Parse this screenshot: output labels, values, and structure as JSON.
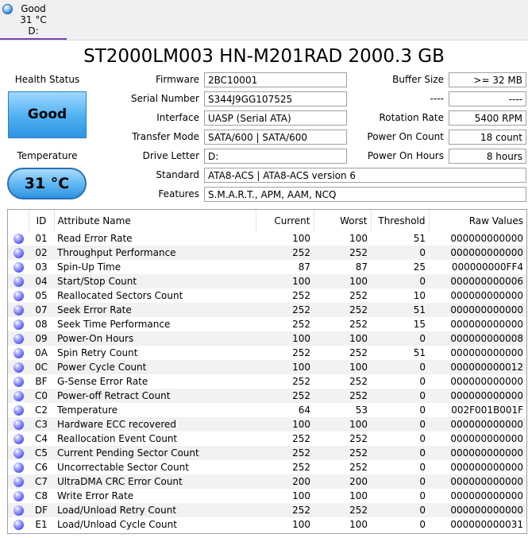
{
  "disk_tab": {
    "status": "Good",
    "temperature": "31 °C",
    "drive": "D:"
  },
  "title": "ST2000LM003 HN-M201RAD 2000.3 GB",
  "health": {
    "label": "Health Status",
    "value": "Good"
  },
  "temperature": {
    "label": "Temperature",
    "value": "31 °C"
  },
  "info_left": [
    {
      "label": "Firmware",
      "value": "2BC10001"
    },
    {
      "label": "Serial Number",
      "value": "S344J9GG107525"
    },
    {
      "label": "Interface",
      "value": "UASP (Serial ATA)"
    },
    {
      "label": "Transfer Mode",
      "value": "SATA/600 | SATA/600"
    },
    {
      "label": "Drive Letter",
      "value": "D:"
    }
  ],
  "info_right": [
    {
      "label": "Buffer Size",
      "value": ">= 32 MB"
    },
    {
      "label": "----",
      "value": "----"
    },
    {
      "label": "Rotation Rate",
      "value": "5400 RPM"
    },
    {
      "label": "Power On Count",
      "value": "18 count"
    },
    {
      "label": "Power On Hours",
      "value": "8 hours"
    }
  ],
  "standard": {
    "label": "Standard",
    "value": "ATA8-ACS | ATA8-ACS version 6"
  },
  "features": {
    "label": "Features",
    "value": "S.M.A.R.T., APM, AAM, NCQ"
  },
  "smart_table": {
    "columns": [
      "ID",
      "Attribute Name",
      "Current",
      "Worst",
      "Threshold",
      "Raw Values"
    ],
    "rows": [
      {
        "id": "01",
        "name": "Read Error Rate",
        "current": "100",
        "worst": "100",
        "threshold": "51",
        "raw": "000000000000"
      },
      {
        "id": "02",
        "name": "Throughput Performance",
        "current": "252",
        "worst": "252",
        "threshold": "0",
        "raw": "000000000000"
      },
      {
        "id": "03",
        "name": "Spin-Up Time",
        "current": "87",
        "worst": "87",
        "threshold": "25",
        "raw": "000000000FF4"
      },
      {
        "id": "04",
        "name": "Start/Stop Count",
        "current": "100",
        "worst": "100",
        "threshold": "0",
        "raw": "000000000006"
      },
      {
        "id": "05",
        "name": "Reallocated Sectors Count",
        "current": "252",
        "worst": "252",
        "threshold": "10",
        "raw": "000000000000"
      },
      {
        "id": "07",
        "name": "Seek Error Rate",
        "current": "252",
        "worst": "252",
        "threshold": "51",
        "raw": "000000000000"
      },
      {
        "id": "08",
        "name": "Seek Time Performance",
        "current": "252",
        "worst": "252",
        "threshold": "15",
        "raw": "000000000000"
      },
      {
        "id": "09",
        "name": "Power-On Hours",
        "current": "100",
        "worst": "100",
        "threshold": "0",
        "raw": "000000000008"
      },
      {
        "id": "0A",
        "name": "Spin Retry Count",
        "current": "252",
        "worst": "252",
        "threshold": "51",
        "raw": "000000000000"
      },
      {
        "id": "0C",
        "name": "Power Cycle Count",
        "current": "100",
        "worst": "100",
        "threshold": "0",
        "raw": "000000000012"
      },
      {
        "id": "BF",
        "name": "G-Sense Error Rate",
        "current": "252",
        "worst": "252",
        "threshold": "0",
        "raw": "000000000000"
      },
      {
        "id": "C0",
        "name": "Power-off Retract Count",
        "current": "252",
        "worst": "252",
        "threshold": "0",
        "raw": "000000000000"
      },
      {
        "id": "C2",
        "name": "Temperature",
        "current": "64",
        "worst": "53",
        "threshold": "0",
        "raw": "002F001B001F"
      },
      {
        "id": "C3",
        "name": "Hardware ECC recovered",
        "current": "100",
        "worst": "100",
        "threshold": "0",
        "raw": "000000000000"
      },
      {
        "id": "C4",
        "name": "Reallocation Event Count",
        "current": "252",
        "worst": "252",
        "threshold": "0",
        "raw": "000000000000"
      },
      {
        "id": "C5",
        "name": "Current Pending Sector Count",
        "current": "252",
        "worst": "252",
        "threshold": "0",
        "raw": "000000000000"
      },
      {
        "id": "C6",
        "name": "Uncorrectable Sector Count",
        "current": "252",
        "worst": "252",
        "threshold": "0",
        "raw": "000000000000"
      },
      {
        "id": "C7",
        "name": "UltraDMA CRC Error Count",
        "current": "200",
        "worst": "200",
        "threshold": "0",
        "raw": "000000000000"
      },
      {
        "id": "C8",
        "name": "Write Error Rate",
        "current": "100",
        "worst": "100",
        "threshold": "0",
        "raw": "000000000000"
      },
      {
        "id": "DF",
        "name": "Load/Unload Retry Count",
        "current": "252",
        "worst": "252",
        "threshold": "0",
        "raw": "000000000000"
      },
      {
        "id": "E1",
        "name": "Load/Unload Cycle Count",
        "current": "100",
        "worst": "100",
        "threshold": "0",
        "raw": "000000000031"
      }
    ]
  },
  "colors": {
    "accent": "#7b3fb0",
    "status_blue": "#3a9be8",
    "row_alt": "#f2f2f2"
  },
  "icons": {
    "disk_status": "blue-circle-icon",
    "attribute_status": "blue-circle-icon"
  }
}
